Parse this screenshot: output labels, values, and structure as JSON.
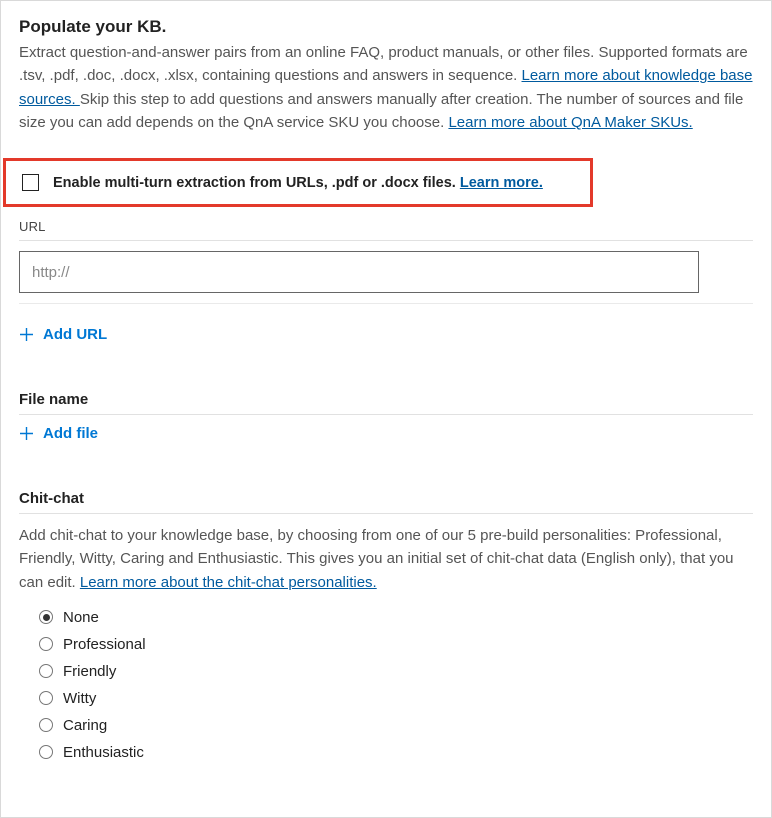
{
  "header": {
    "title": "Populate your KB.",
    "desc_part1": "Extract question-and-answer pairs from an online FAQ, product manuals, or other files. Supported formats are .tsv, .pdf, .doc, .docx, .xlsx, containing questions and answers in sequence. ",
    "link1": "Learn more about knowledge base sources. ",
    "desc_part2": "Skip this step to add questions and answers manually after creation. The number of sources and file size you can add depends on the QnA service SKU you choose. ",
    "link2": "Learn more about QnA Maker SKUs."
  },
  "multiturn": {
    "label": "Enable multi-turn extraction from URLs, .pdf or .docx files. ",
    "link": "Learn more."
  },
  "url": {
    "label": "URL",
    "placeholder": "http://",
    "add": "Add URL"
  },
  "file": {
    "label": "File name",
    "add": "Add file"
  },
  "chitchat": {
    "label": "Chit-chat",
    "desc_part1": "Add chit-chat to your knowledge base, by choosing from one of our 5 pre-build personalities: Professional, Friendly, Witty, Caring and Enthusiastic. This gives you an initial set of chit-chat data (English only), that you can edit. ",
    "link": "Learn more about the chit-chat personalities.",
    "options": [
      "None",
      "Professional",
      "Friendly",
      "Witty",
      "Caring",
      "Enthusiastic"
    ],
    "selected": "None"
  }
}
